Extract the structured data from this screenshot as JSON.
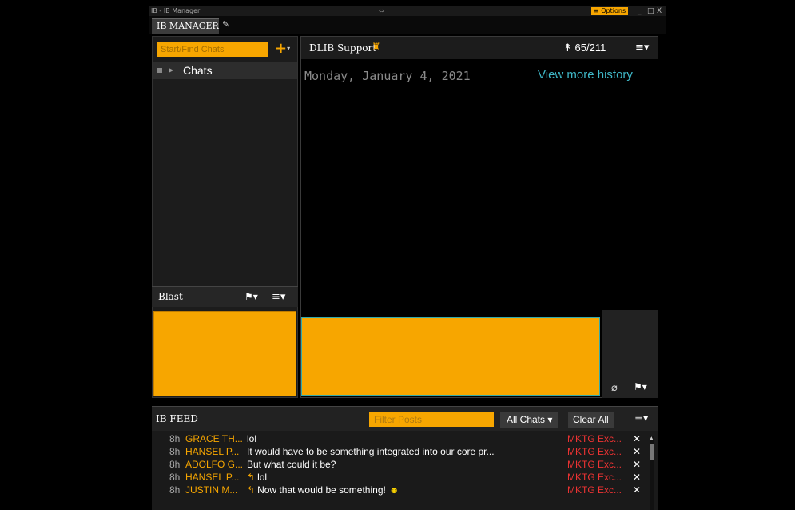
{
  "window": {
    "title": "IB - IB Manager",
    "center_marker": "⇔",
    "options_label": "Options",
    "controls": [
      "_",
      "□",
      "X"
    ]
  },
  "tab": {
    "label": "IB MANAGER"
  },
  "left_panel": {
    "search_placeholder": "Start/Find Chats",
    "chats_label": "Chats",
    "blast_label": "Blast"
  },
  "chat": {
    "title": "DLIB Support",
    "count": "65/211",
    "date": "Monday, January 4, 2021",
    "more_history": "View more history"
  },
  "feed": {
    "title": "IB FEED",
    "filter_placeholder": "Filter Posts",
    "all_chats": "All Chats",
    "clear_all": "Clear All",
    "rows": [
      {
        "age": "8h",
        "who": "GRACE TH...",
        "reply": "",
        "msg": "lol",
        "group": "MKTG Exc...",
        "smile": ""
      },
      {
        "age": "8h",
        "who": "HANSEL P...",
        "reply": "",
        "msg": "It would have to be something integrated into our core pr...",
        "group": "MKTG Exc...",
        "smile": ""
      },
      {
        "age": "8h",
        "who": "ADOLFO G...",
        "reply": "",
        "msg": "But what could it be?",
        "group": "MKTG Exc...",
        "smile": ""
      },
      {
        "age": "8h",
        "who": "HANSEL P...",
        "reply": "↰",
        "msg": "lol",
        "group": "MKTG Exc...",
        "smile": ""
      },
      {
        "age": "8h",
        "who": "JUSTIN M...",
        "reply": "↰",
        "msg": "Now that would be something!",
        "group": "MKTG Exc...",
        "smile": "☻"
      }
    ]
  }
}
